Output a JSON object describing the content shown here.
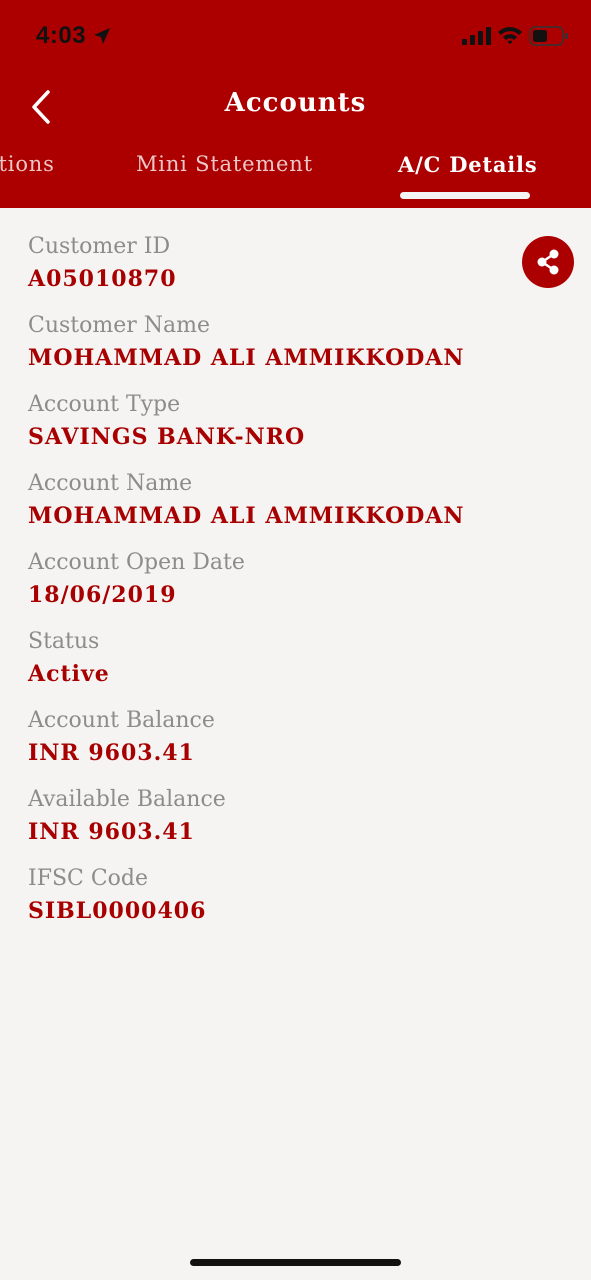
{
  "status_bar": {
    "time": "4:03"
  },
  "header": {
    "title": "Accounts"
  },
  "tabs": [
    {
      "label": "ctions",
      "active": false
    },
    {
      "label": "Mini Statement",
      "active": false
    },
    {
      "label": "A/C Details",
      "active": true
    }
  ],
  "details": [
    {
      "label": "Customer ID",
      "value": "A05010870"
    },
    {
      "label": "Customer Name",
      "value": "MOHAMMAD ALI AMMIKKODAN"
    },
    {
      "label": "Account Type",
      "value": "SAVINGS BANK-NRO"
    },
    {
      "label": "Account Name",
      "value": "MOHAMMAD ALI AMMIKKODAN"
    },
    {
      "label": "Account Open Date",
      "value": "18/06/2019"
    },
    {
      "label": "Status",
      "value": "Active"
    },
    {
      "label": "Account Balance",
      "value": "INR 9603.41"
    },
    {
      "label": "Available Balance",
      "value": "INR 9603.41"
    },
    {
      "label": "IFSC Code",
      "value": "SIBL0000406"
    }
  ],
  "icons": {
    "back": "chevron-left-icon",
    "share": "share-icon",
    "location": "location-arrow-icon",
    "signal": "cellular-signal-icon",
    "wifi": "wifi-icon",
    "battery": "battery-icon"
  },
  "colors": {
    "brand": "#ac0000",
    "value_text": "#a80000",
    "label_text": "#8c8c8c",
    "background": "#f5f4f2"
  }
}
